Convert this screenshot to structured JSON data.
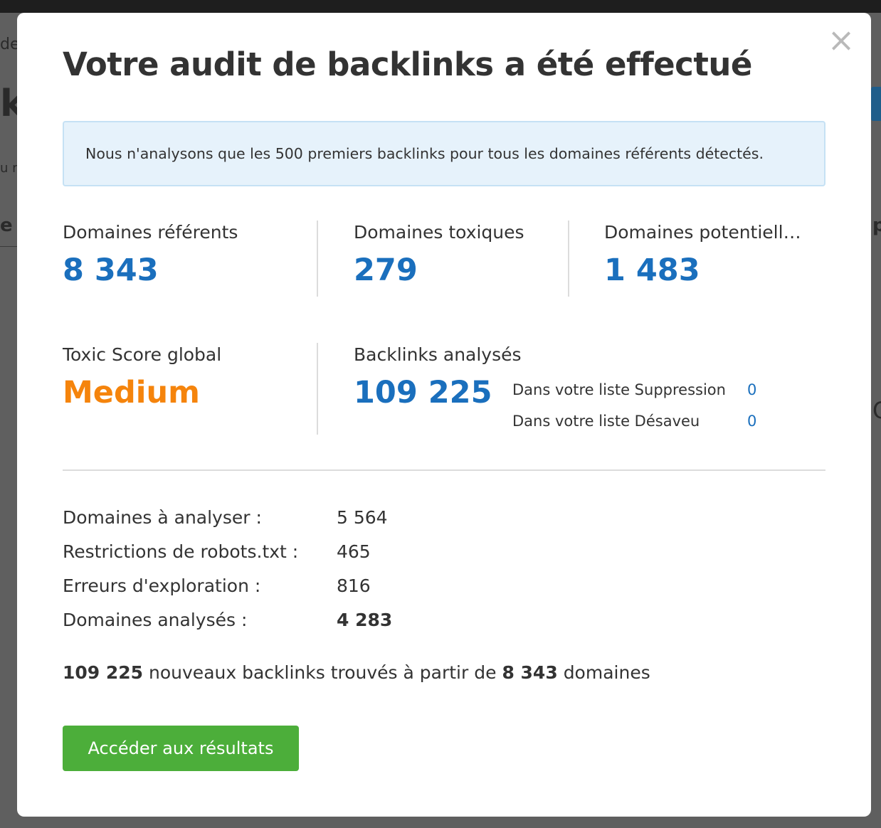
{
  "modal": {
    "title": "Votre audit de backlinks a été effectué",
    "close_glyph": "×",
    "notice": "Nous n'analysons que les 500 premiers backlinks pour tous les domaines référents détectés."
  },
  "metrics": {
    "referring_domains": {
      "label": "Domaines référents",
      "value": "8 343"
    },
    "toxic_domains": {
      "label": "Domaines toxiques",
      "value": "279"
    },
    "potential_domains": {
      "label": "Domaines potentiell…",
      "value": "1 483"
    },
    "toxic_score": {
      "label": "Toxic Score global",
      "value": "Medium",
      "color": "#f5840c"
    },
    "backlinks_analyzed": {
      "label": "Backlinks analysés",
      "value": "109 225"
    }
  },
  "lists": [
    {
      "label": "Dans votre liste Suppression",
      "value": "0"
    },
    {
      "label": "Dans votre liste Désaveu",
      "value": "0"
    }
  ],
  "stats": [
    {
      "label": "Domaines à analyser :",
      "value": "5 564"
    },
    {
      "label": "Restrictions de robots.txt :",
      "value": "465"
    },
    {
      "label": "Erreurs d'exploration :",
      "value": "816"
    },
    {
      "label": "Domaines analysés :",
      "value": "4 283"
    }
  ],
  "summary": {
    "backlinks": "109 225",
    "middle": "nouveaux backlinks trouvés à partir de",
    "domains": "8 343",
    "end": "domaines"
  },
  "cta_label": "Accéder aux résultats",
  "background_fragments": {
    "a": "de",
    "b": "k",
    "c": "u r",
    "d": "e",
    "e": "p",
    "f": "O"
  },
  "colors": {
    "accent_blue": "#1a6fbd",
    "medium_orange": "#f5840c",
    "cta_green": "#4cae3a",
    "notice_bg": "#e6f2fb"
  }
}
